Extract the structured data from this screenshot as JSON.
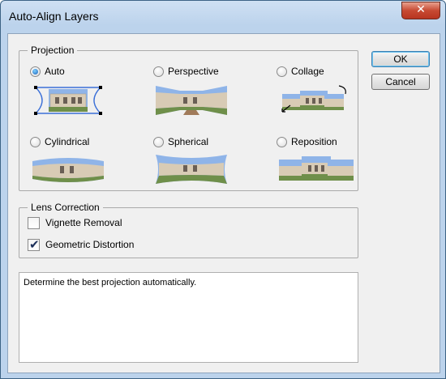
{
  "window": {
    "title": "Auto-Align Layers",
    "close_glyph": "✕"
  },
  "buttons": {
    "ok": "OK",
    "cancel": "Cancel"
  },
  "projection": {
    "legend": "Projection",
    "selected": "Auto",
    "options": [
      {
        "label": "Auto",
        "icon": "auto-projection-icon"
      },
      {
        "label": "Perspective",
        "icon": "perspective-projection-icon"
      },
      {
        "label": "Collage",
        "icon": "collage-projection-icon"
      },
      {
        "label": "Cylindrical",
        "icon": "cylindrical-projection-icon"
      },
      {
        "label": "Spherical",
        "icon": "spherical-projection-icon"
      },
      {
        "label": "Reposition",
        "icon": "reposition-projection-icon"
      }
    ]
  },
  "lens_correction": {
    "legend": "Lens Correction",
    "vignette": {
      "label": "Vignette Removal",
      "checked": false
    },
    "geometric": {
      "label": "Geometric Distortion",
      "checked": true
    }
  },
  "description": "Determine the best projection automatically.",
  "colors": {
    "sky": "#8fb4e8",
    "building": "#d8cbb5",
    "grass": "#6f8f4a",
    "accent_blue": "#3a6fd8"
  }
}
